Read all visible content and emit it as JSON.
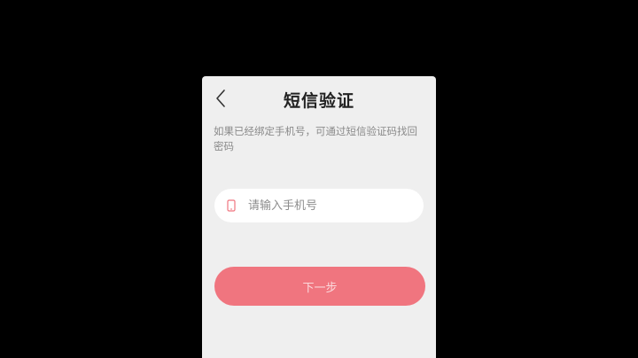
{
  "header": {
    "title": "短信验证",
    "back_icon": "chevron-left-icon"
  },
  "hint": {
    "text": "如果已经绑定手机号，可通过短信验证码找回密码"
  },
  "phone_field": {
    "icon": "phone-icon",
    "value": "",
    "placeholder": "请输入手机号"
  },
  "next_button": {
    "label": "下一步"
  },
  "colors": {
    "background": "#000000",
    "panel": "#efefef",
    "accent": "#f0757f",
    "button_text": "#fbd9dc"
  }
}
